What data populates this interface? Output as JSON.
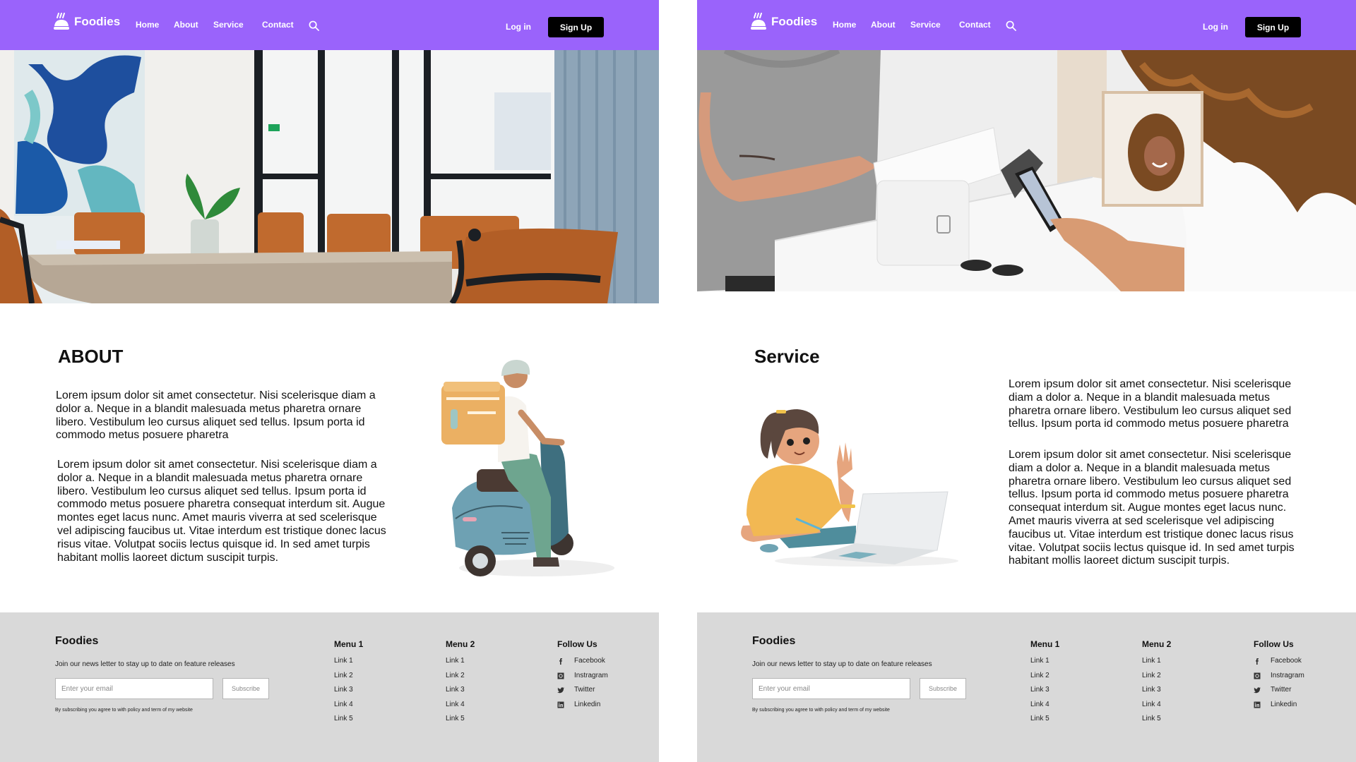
{
  "brand": {
    "name": "Foodies",
    "accent": "#9a63fb",
    "icon": "food-cloche-icon"
  },
  "nav": {
    "items": [
      {
        "label": "Home"
      },
      {
        "label": "About"
      },
      {
        "label": "Service"
      },
      {
        "label": "Contact"
      }
    ],
    "search_icon": "search-icon",
    "login_label": "Log in",
    "signup_label": "Sign Up"
  },
  "pages": {
    "about": {
      "hero_alt": "Meeting room with wooden table, orange chairs and blue abstract painting",
      "title": "ABOUT",
      "paragraphs": [
        "Lorem ipsum dolor sit amet consectetur. Nisi scelerisque diam a dolor a. Neque in a blandit malesuada metus pharetra ornare libero. Vestibulum leo cursus aliquet sed tellus. Ipsum porta id commodo metus posuere pharetra",
        "Lorem ipsum dolor sit amet consectetur. Nisi scelerisque diam a dolor a. Neque in a blandit malesuada metus pharetra ornare libero. Vestibulum leo cursus aliquet sed tellus. Ipsum porta id commodo metus posuere pharetra consequat interdum sit. Augue montes eget lacus nunc. Amet mauris viverra at sed scelerisque vel adipiscing faucibus ut. Vitae interdum est tristique donec lacus risus vitae. Volutpat sociis lectus quisque id. In sed amet turpis habitant mollis laoreet dictum suscipit turpis."
      ],
      "illustration": "delivery-scooter-illustration"
    },
    "service": {
      "hero_alt": "Customer paying with phone at a checkout counter",
      "title": "Service",
      "paragraphs": [
        "Lorem ipsum dolor sit amet consectetur. Nisi scelerisque diam a dolor a. Neque in a blandit malesuada metus pharetra ornare libero. Vestibulum leo cursus aliquet sed tellus. Ipsum porta id commodo metus posuere pharetra",
        "Lorem ipsum dolor sit amet consectetur. Nisi scelerisque diam a dolor a. Neque in a blandit malesuada metus pharetra ornare libero. Vestibulum leo cursus aliquet sed tellus. Ipsum porta id commodo metus posuere pharetra consequat interdum sit. Augue montes eget lacus nunc. Amet mauris viverra at sed scelerisque vel adipiscing faucibus ut. Vitae interdum est tristique donec lacus risus vitae. Volutpat sociis lectus quisque id. In sed amet turpis habitant mollis laoreet dictum suscipit turpis."
      ],
      "illustration": "girl-with-laptop-illustration"
    }
  },
  "footer": {
    "brand": "Foodies",
    "newsletter_text": "Join our news letter to stay up to date on feature releases",
    "email_placeholder": "Enter your email",
    "email_value": "",
    "subscribe_label": "Subscribe",
    "policy_text": "By subscribing you agree to with policy and term of my website",
    "menu1": {
      "title": "Menu 1",
      "links": [
        "Link 1",
        "Link 2",
        "Link 3",
        "Link 4",
        "Link 5"
      ]
    },
    "menu2": {
      "title": "Menu 2",
      "links": [
        "Link 1",
        "Link 2",
        "Link 3",
        "Link 4",
        "Link 5"
      ]
    },
    "follow": {
      "title": "Follow Us",
      "items": [
        {
          "label": "Facebook",
          "icon": "facebook-icon"
        },
        {
          "label": "Instragram",
          "icon": "instagram-icon"
        },
        {
          "label": "Twitter",
          "icon": "twitter-icon"
        },
        {
          "label": "Linkedin",
          "icon": "linkedin-icon"
        }
      ]
    }
  }
}
